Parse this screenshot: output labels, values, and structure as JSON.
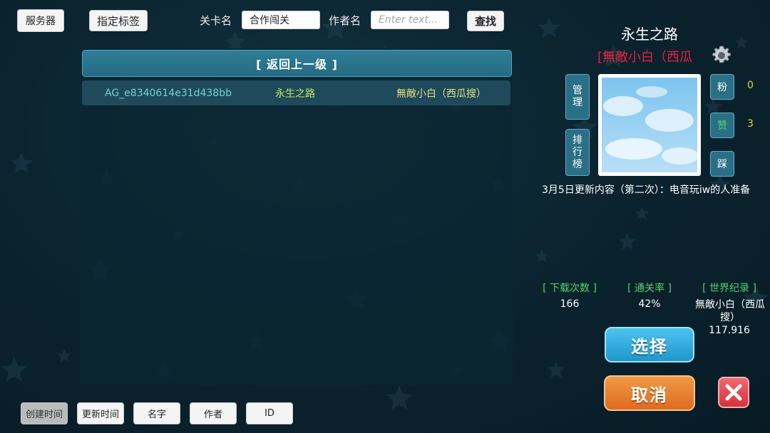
{
  "toolbar": {
    "server_label": "服务器",
    "tag_label": "指定标签",
    "level_name_label": "关卡名",
    "level_name_value": "合作闯关",
    "author_label": "作者名",
    "author_placeholder": "Enter text...",
    "search_label": "查找"
  },
  "list": {
    "back_label": "[ 返回上一级 ]",
    "rows": [
      {
        "id": "AG_e8340614e31d438bb",
        "name": "永生之路",
        "author": "無敵小白（西瓜搜）"
      }
    ]
  },
  "sort": {
    "buttons": [
      "创建时间",
      "更新时间",
      "名字",
      "作者",
      "ID"
    ],
    "active_index": 0
  },
  "detail": {
    "title": "永生之路",
    "author_line": "[無敵小白（西瓜",
    "manage_label": "管理",
    "rank_label": "排行榜",
    "fans_label": "粉",
    "fans_count": "0",
    "like_label": "赞",
    "like_count": "3",
    "dislike_label": "踩",
    "description": "3月5日更新内容（第二次）：电音玩iw的人准备",
    "stats": {
      "downloads_label": "[ 下载次数 ]",
      "downloads_value": "166",
      "clear_rate_label": "[ 通关率 ]",
      "clear_rate_value": "42%",
      "record_label": "[ 世界纪录 ]",
      "record_holder": "無敵小白（西瓜搜）",
      "record_time": "117.916"
    },
    "select_label": "选择",
    "cancel_label": "取消"
  },
  "icons": {
    "settings": "gear-icon",
    "close": "close-icon",
    "thumbnail": "sky-thumbnail"
  },
  "colors": {
    "title_author_red": "#e8203a",
    "row_id": "#6fd3d0",
    "row_name": "#c6e65a",
    "row_author": "#e8df7a",
    "stat_green": "#4fd46a",
    "count_yellow": "#e6d640",
    "select_blue": "#2fa9da",
    "cancel_orange": "#e9782a",
    "close_red": "#e0404a"
  }
}
